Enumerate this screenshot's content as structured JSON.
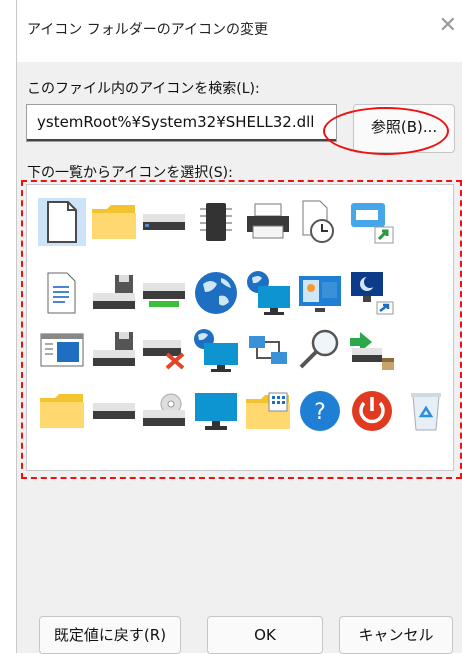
{
  "dialog": {
    "title": "アイコン フォルダーのアイコンの変更",
    "search_label": "このファイル内のアイコンを検索(L):",
    "path_value": "ystemRoot%¥System32¥SHELL32.dll",
    "browse_label": "参照(B)...",
    "list_label": "下の一覧からアイコンを選択(S):",
    "restore_label": "既定値に戻す(R)",
    "ok_label": "OK",
    "cancel_label": "キャンセル"
  },
  "icons": [
    [
      "blank-document-icon",
      "folder-icon",
      "drive-icon",
      "chip-icon",
      "printer-icon",
      "clock-document-icon",
      "window-shortcut-icon"
    ],
    [
      "text-document-icon",
      "floppy-drive-icon",
      "network-drive-icon",
      "globe-icon",
      "network-globe-icon",
      "control-panel-icon",
      "monitor-sleep-icon"
    ],
    [
      "window-icon",
      "floppy-drive-2-icon",
      "disconnected-drive-icon",
      "globe-monitor-icon",
      "network-connection-icon",
      "search-magnifier-icon",
      "removable-drive-icon"
    ],
    [
      "folder-2-icon",
      "drive-2-icon",
      "cd-drive-icon",
      "monitor-icon",
      "folder-grid-icon",
      "help-icon",
      "power-icon",
      "recycle-bin-icon"
    ]
  ]
}
